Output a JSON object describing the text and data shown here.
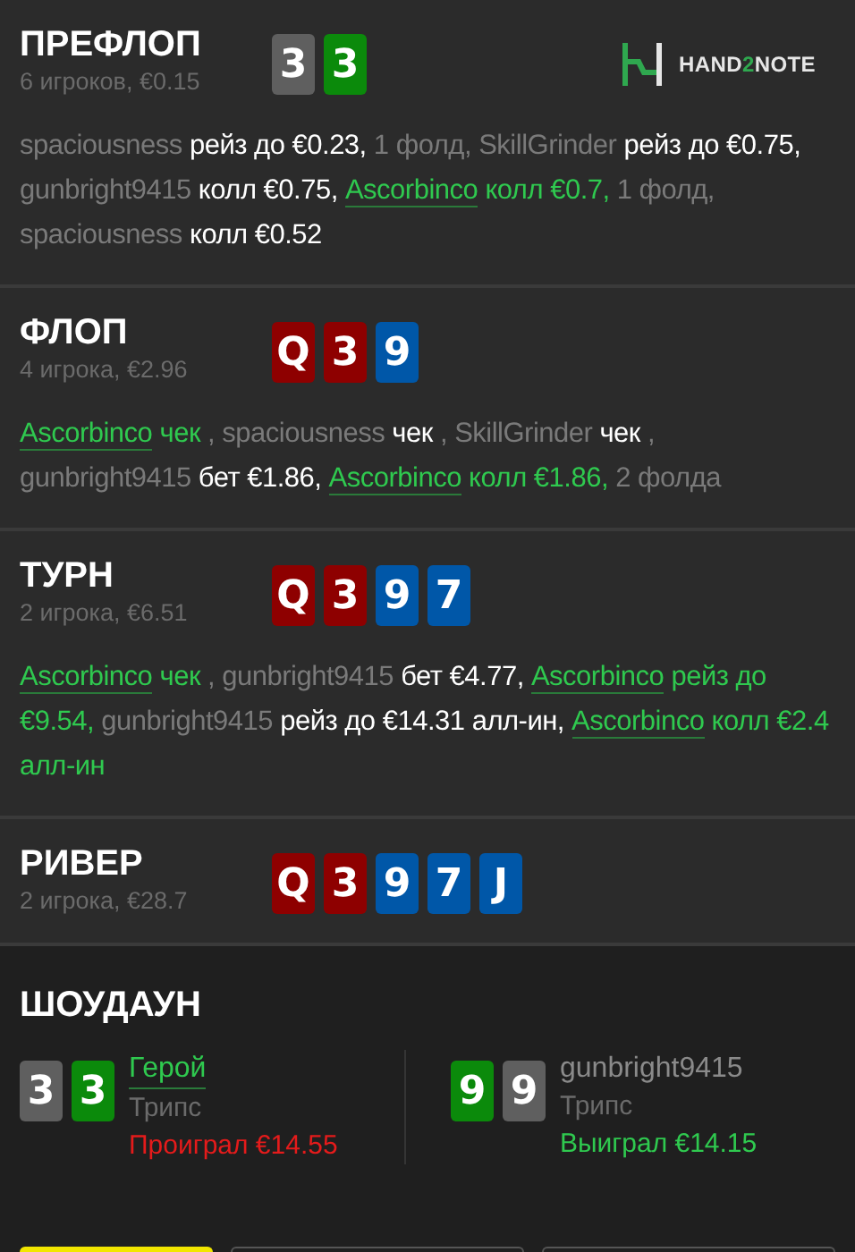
{
  "logo": {
    "parts": [
      "HAND",
      "2",
      "NOTE"
    ]
  },
  "streets": [
    {
      "title": "ПРЕФЛОП",
      "sub": "6 игроков, €0.15",
      "cards": [
        {
          "rank": "3",
          "color": "#5f5f5f"
        },
        {
          "rank": "3",
          "color": "#0b8a0b"
        }
      ],
      "actions": [
        {
          "kind": "player",
          "text": "spaciousness "
        },
        {
          "kind": "act",
          "text": "рейз до €0.23, "
        },
        {
          "kind": "muted",
          "text": "1 фолд, "
        },
        {
          "kind": "player",
          "text": "SkillGrinder "
        },
        {
          "kind": "act",
          "text": "рейз до €0.75, "
        },
        {
          "kind": "player",
          "text": "gunbright9415 "
        },
        {
          "kind": "act",
          "text": "колл €0.75, "
        },
        {
          "kind": "hero",
          "text": "Ascorbinco"
        },
        {
          "kind": "heroact",
          "text": " колл €0.7, "
        },
        {
          "kind": "muted",
          "text": "1 фолд, "
        },
        {
          "kind": "player",
          "text": "spaciousness "
        },
        {
          "kind": "act",
          "text": "колл €0.52"
        }
      ]
    },
    {
      "title": "ФЛОП",
      "sub": "4 игрока, €2.96",
      "cards": [
        {
          "rank": "Q",
          "color": "#8e0000"
        },
        {
          "rank": "3",
          "color": "#8e0000"
        },
        {
          "rank": "9",
          "color": "#0057a8"
        }
      ],
      "actions": [
        {
          "kind": "hero",
          "text": "Ascorbinco"
        },
        {
          "kind": "heroact",
          "text": " чек "
        },
        {
          "kind": "muted",
          "text": ", "
        },
        {
          "kind": "player",
          "text": "spaciousness "
        },
        {
          "kind": "act",
          "text": "чек "
        },
        {
          "kind": "muted",
          "text": ", "
        },
        {
          "kind": "player",
          "text": "SkillGrinder "
        },
        {
          "kind": "act",
          "text": "чек "
        },
        {
          "kind": "muted",
          "text": ", "
        },
        {
          "kind": "player",
          "text": "gunbright9415 "
        },
        {
          "kind": "act",
          "text": "бет €1.86, "
        },
        {
          "kind": "hero",
          "text": "Ascorbinco"
        },
        {
          "kind": "heroact",
          "text": " колл €1.86, "
        },
        {
          "kind": "muted",
          "text": "2 фолда"
        }
      ]
    },
    {
      "title": "ТУРН",
      "sub": "2 игрока, €6.51",
      "cards": [
        {
          "rank": "Q",
          "color": "#8e0000"
        },
        {
          "rank": "3",
          "color": "#8e0000"
        },
        {
          "rank": "9",
          "color": "#0057a8"
        },
        {
          "rank": "7",
          "color": "#0057a8"
        }
      ],
      "actions": [
        {
          "kind": "hero",
          "text": "Ascorbinco"
        },
        {
          "kind": "heroact",
          "text": " чек "
        },
        {
          "kind": "muted",
          "text": ", "
        },
        {
          "kind": "player",
          "text": "gunbright9415 "
        },
        {
          "kind": "act",
          "text": "бет €4.77, "
        },
        {
          "kind": "hero",
          "text": "Ascorbinco"
        },
        {
          "kind": "heroact",
          "text": " рейз до €9.54, "
        },
        {
          "kind": "player",
          "text": "gunbright9415 "
        },
        {
          "kind": "act",
          "text": "рейз до €14.31 алл-ин, "
        },
        {
          "kind": "hero",
          "text": "Ascorbinco"
        },
        {
          "kind": "heroact",
          "text": " колл €2.4 алл-ин"
        }
      ]
    },
    {
      "title": "РИВЕР",
      "sub": "2 игрока, €28.7",
      "cards": [
        {
          "rank": "Q",
          "color": "#8e0000"
        },
        {
          "rank": "3",
          "color": "#8e0000"
        },
        {
          "rank": "9",
          "color": "#0057a8"
        },
        {
          "rank": "7",
          "color": "#0057a8"
        },
        {
          "rank": "J",
          "color": "#0057a8"
        }
      ]
    }
  ],
  "showdown": {
    "title": "ШОУДАУН",
    "players": [
      {
        "name": "Герой",
        "hero": true,
        "hand": "Трипс",
        "result": "Проиграл €14.55",
        "won": false,
        "cards": [
          {
            "rank": "3",
            "color": "#5f5f5f"
          },
          {
            "rank": "3",
            "color": "#0b8a0b"
          }
        ]
      },
      {
        "name": "gunbright9415",
        "hero": false,
        "hand": "Трипс",
        "result": "Выиграл €14.15",
        "won": true,
        "cards": [
          {
            "rank": "9",
            "color": "#0b8a0b"
          },
          {
            "rank": "9",
            "color": "#5f5f5f"
          }
        ]
      }
    ]
  },
  "buttons": [
    {
      "kind": "primary"
    },
    {
      "kind": "outline"
    },
    {
      "kind": "outline"
    }
  ]
}
